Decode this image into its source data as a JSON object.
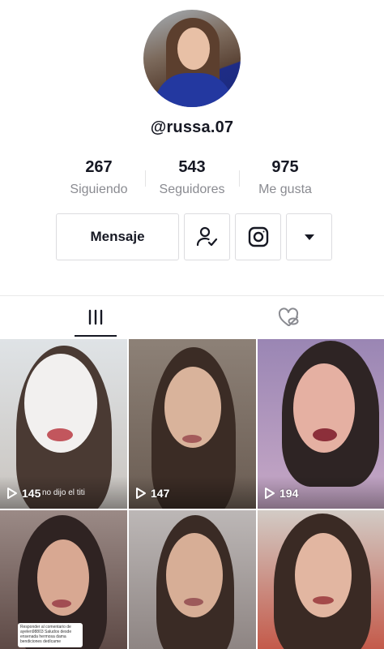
{
  "profile": {
    "username": "@russa.07"
  },
  "stats": [
    {
      "value": "267",
      "label": "Siguiendo"
    },
    {
      "value": "543",
      "label": "Seguidores"
    },
    {
      "value": "975",
      "label": "Me gusta"
    }
  ],
  "actions": {
    "message_label": "Mensaje",
    "follow_icon": "user-check-icon",
    "instagram_icon": "instagram-icon",
    "more_icon": "caret-down-icon"
  },
  "tabs": [
    {
      "icon": "videos-grid-icon",
      "active": true
    },
    {
      "icon": "liked-hidden-icon",
      "active": false
    }
  ],
  "videos": [
    {
      "views": "145",
      "caption": "no dijo el titi"
    },
    {
      "views": "147"
    },
    {
      "views": "194"
    },
    {
      "views": ""
    },
    {
      "views": ""
    },
    {
      "views": ""
    }
  ],
  "reply_bubble": {
    "text": "Responder al comentario de ayelen98803 Saludos desde ensenada hermosa dama bendiciones dedícame"
  },
  "colors": {
    "text": "#161823",
    "secondary": "#8a8b91",
    "border": "#dcdcdf"
  }
}
